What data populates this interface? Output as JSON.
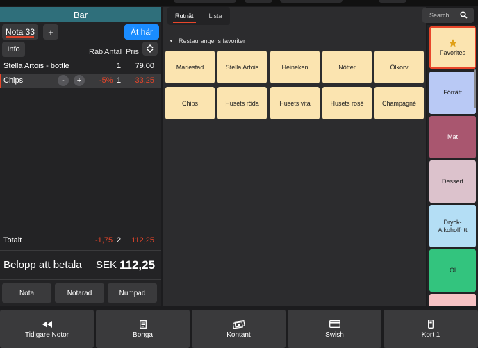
{
  "order": {
    "location": "Bar",
    "note_label": "Nota 33",
    "add_label": "+",
    "eat_here_label": "Ät här",
    "info_label": "Info",
    "columns": {
      "discount": "Rab",
      "qty": "Antal",
      "price": "Pris"
    },
    "items": [
      {
        "name": "Stella Artois - bottle",
        "discount": "",
        "qty": "1",
        "price": "79,00",
        "selected": false
      },
      {
        "name": "Chips",
        "discount": "-5%",
        "qty": "1",
        "price": "33,25",
        "selected": true
      }
    ],
    "minus_label": "-",
    "plus_label": "+",
    "total": {
      "label": "Totalt",
      "discount": "-1,75",
      "qty": "2",
      "amount": "112,25"
    },
    "pay": {
      "label": "Belopp att betala",
      "currency": "SEK",
      "amount": "112,25"
    },
    "buttons": [
      "Nota",
      "Notarad",
      "Numpad"
    ]
  },
  "products": {
    "tabs": [
      {
        "label": "Rutnät",
        "active": true
      },
      {
        "label": "Lista",
        "active": false
      }
    ],
    "category_title": "Restaurangens favoriter",
    "items": [
      "Mariestad",
      "Stella Artois",
      "Heineken",
      "Nötter",
      "Ölkorv",
      "Chips",
      "Husets röda",
      "Husets vita",
      "Husets rosé",
      "Champagné"
    ]
  },
  "search": {
    "placeholder": "Search"
  },
  "categories": [
    {
      "label": "Favorites",
      "color": "#fbe4b0",
      "icon": "star-icon"
    },
    {
      "label": "Förrätt",
      "color": "#b9c9f5",
      "icon": ""
    },
    {
      "label": "Mat",
      "color": "#a9566f",
      "icon": ""
    },
    {
      "label": "Dessert",
      "color": "#dcc2cc",
      "icon": ""
    },
    {
      "label": "Dryck-\nAlkoholfritt",
      "color": "#b4def5",
      "icon": ""
    },
    {
      "label": "Öl",
      "color": "#33c47e",
      "icon": ""
    },
    {
      "label": "",
      "color": "#f7c3c4",
      "icon": ""
    }
  ],
  "footer": [
    {
      "label": "Tidigare Notor",
      "icon": "rewind-icon"
    },
    {
      "label": "Bonga",
      "icon": "receipt-icon"
    },
    {
      "label": "Kontant",
      "icon": "cash-icon"
    },
    {
      "label": "Swish",
      "icon": "card-icon"
    },
    {
      "label": "Kort 1",
      "icon": "card-terminal-icon"
    }
  ],
  "colors": {
    "accent_red": "#e8462a",
    "accent_blue": "#1a8cff",
    "header_teal": "#2f6f7b"
  }
}
